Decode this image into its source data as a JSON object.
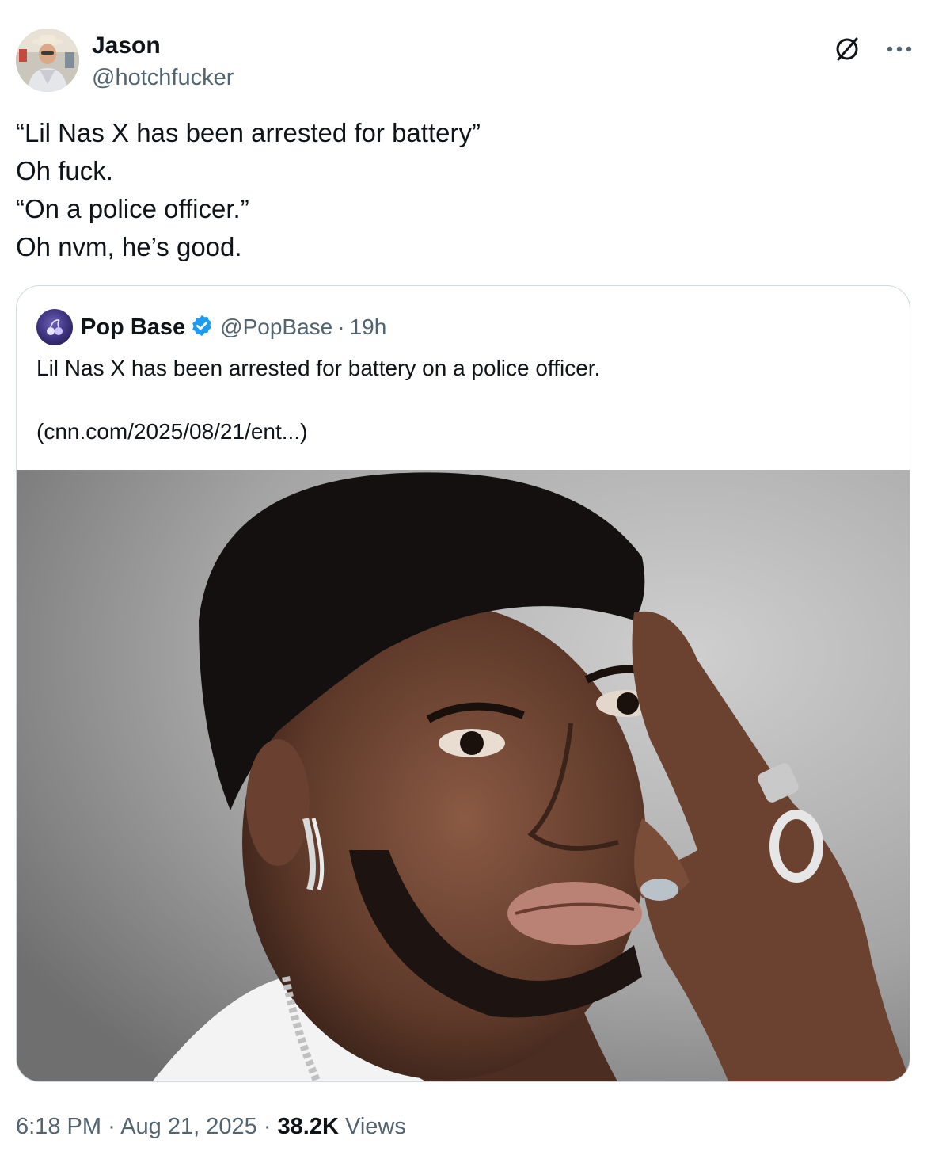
{
  "tweet": {
    "author": {
      "name": "Jason",
      "handle": "@hotchfucker"
    },
    "lines": [
      "“Lil Nas X has been arrested for battery”",
      "Oh fuck.",
      "“On a police officer.”",
      "Oh nvm, he’s good."
    ],
    "time": "6:18 PM",
    "date": "Aug 21, 2025",
    "views_count": "38.2K",
    "views_label": "Views",
    "separator": "·"
  },
  "quoted": {
    "name": "Pop Base",
    "handle": "@PopBase",
    "age": "19h",
    "text": "Lil Nas X has been arrested for battery on a police officer.",
    "link": "(cnn.com/2025/08/21/ent...)"
  },
  "icons": {
    "grok": "grok-icon",
    "more": "more-icon",
    "verified": "verified-badge-icon"
  },
  "colors": {
    "text": "#0f1419",
    "secondary": "#536471",
    "border": "#cfd9de",
    "verified": "#1d9bf0"
  }
}
